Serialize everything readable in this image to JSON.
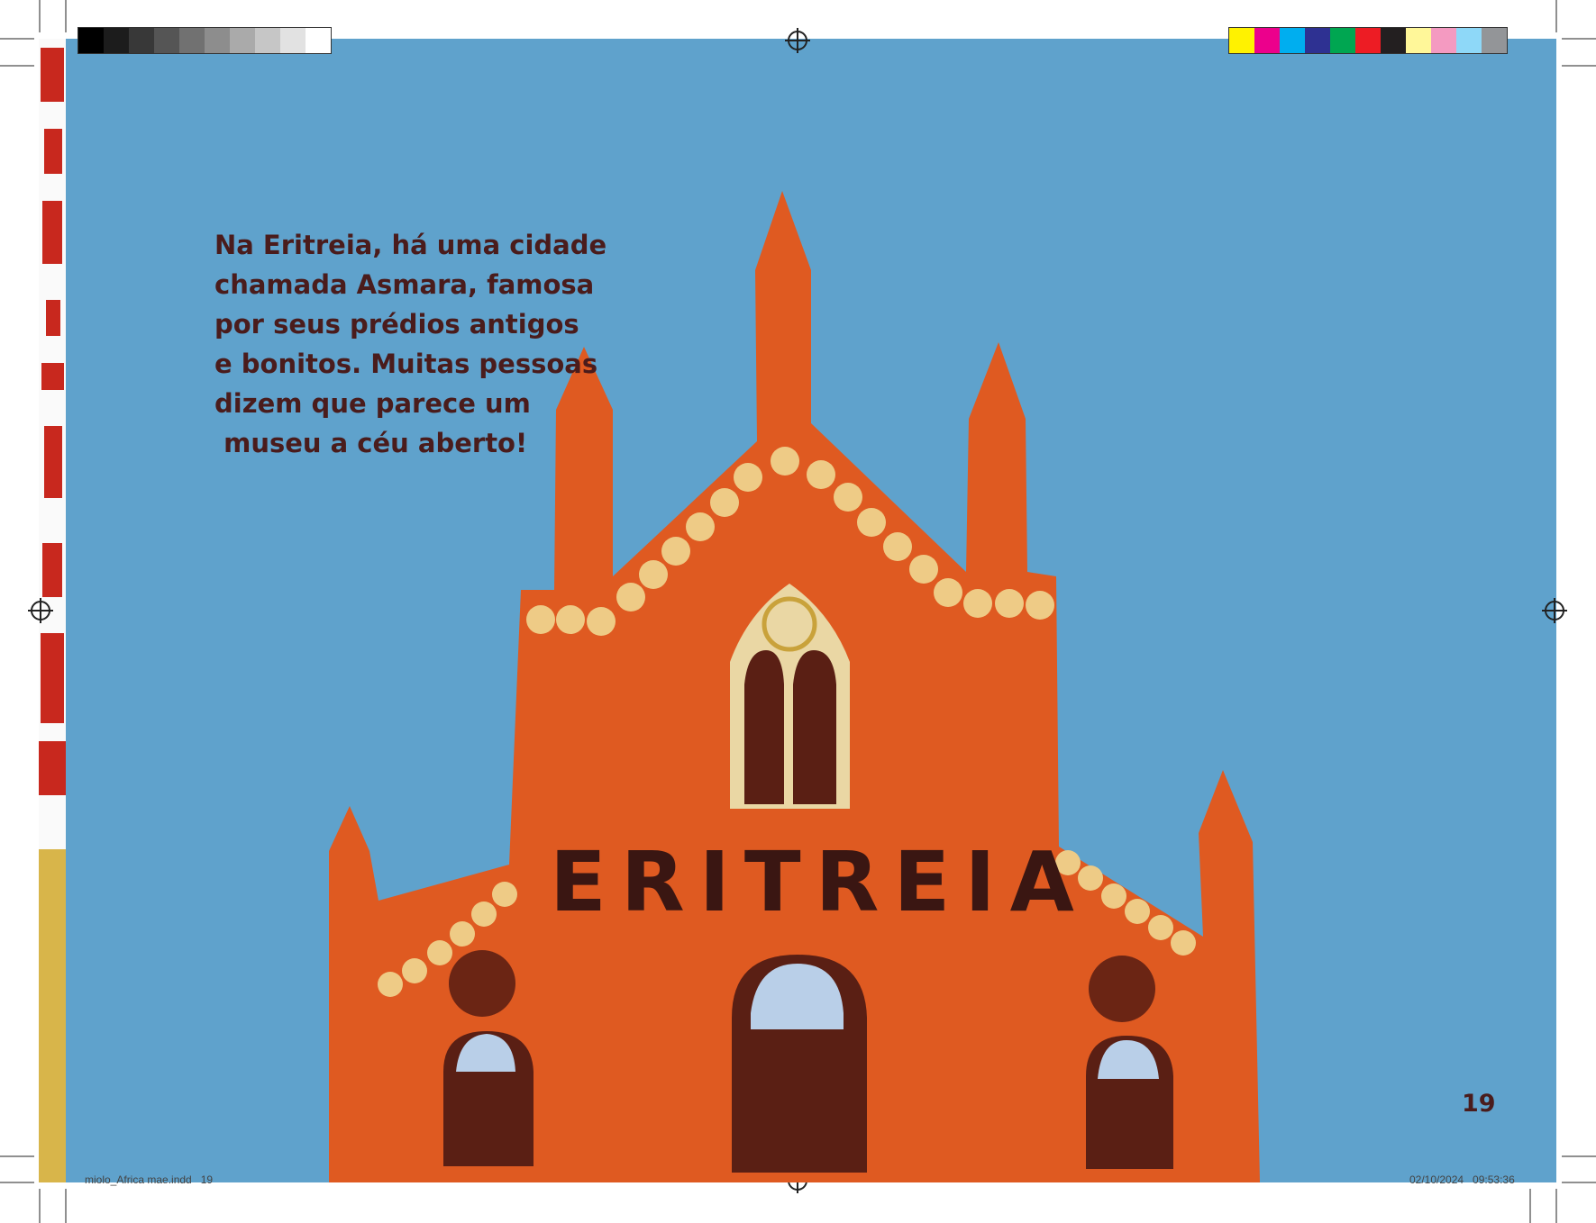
{
  "story": {
    "lines": [
      "Na Eritreia, há uma cidade",
      "chamada Asmara, famosa",
      "por seus prédios antigos",
      "e bonitos. Muitas pessoas",
      "dizem que parece um",
      " museu a céu aberto!"
    ]
  },
  "illustration": {
    "building_label": "ERITREIA",
    "icon": "cathedral-illustration",
    "colors": {
      "sky": "#5fa2cc",
      "building": "#df5a21",
      "scallops": "#eecb86",
      "doors": "#5a1f14",
      "glass": "#b9cfe8",
      "window_frame": "#ead7a4",
      "rose_window": "#c9a23b"
    }
  },
  "page_number": "19",
  "print_marks": {
    "slug_left": "miolo_Africa mae.indd   19",
    "slug_right": "02/10/2024   09:53:36",
    "grey_swatches": [
      "#000000",
      "#1c1c1c",
      "#383838",
      "#555555",
      "#717171",
      "#8d8d8d",
      "#aaaaaa",
      "#c6c6c6",
      "#e2e2e2",
      "#ffffff"
    ],
    "color_swatches": [
      "#fff200",
      "#ec008c",
      "#00aeef",
      "#2e3192",
      "#00a651",
      "#ed1c24",
      "#231f20",
      "#fff799",
      "#f49ac1",
      "#8ed8f8",
      "#939598"
    ]
  }
}
